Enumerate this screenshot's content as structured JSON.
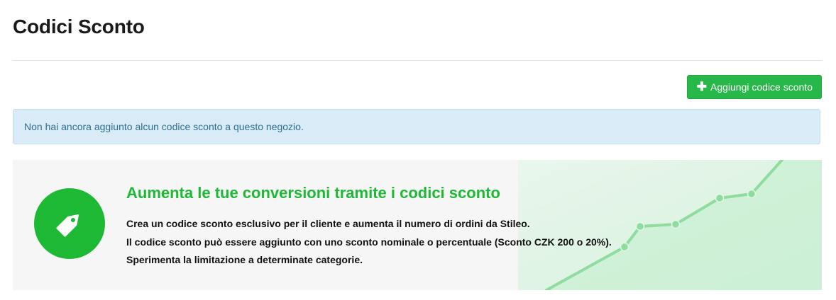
{
  "page": {
    "title": "Codici Sconto"
  },
  "toolbar": {
    "add_label": "Aggiungi codice sconto",
    "add_icon": "plus-icon"
  },
  "alert": {
    "text": "Non hai ancora aggiunto alcun codice sconto a questo negozio."
  },
  "promo": {
    "icon": "tag-icon",
    "heading": "Aumenta le tue conversioni tramite i codici sconto",
    "lines": [
      "Crea un codice sconto esclusivo per il cliente e aumenta il numero di ordini da Stileo.",
      "Il codice sconto può essere aggiunto con uno sconto nominale o percentuale (Sconto CZK 200 o 20%).",
      "Sperimenta la limitazione a determinate categorie."
    ]
  },
  "colors": {
    "accent_green": "#1eb934",
    "button_green": "#28b84a",
    "info_bg": "#d8ebf7",
    "info_text": "#2f6e8f"
  }
}
